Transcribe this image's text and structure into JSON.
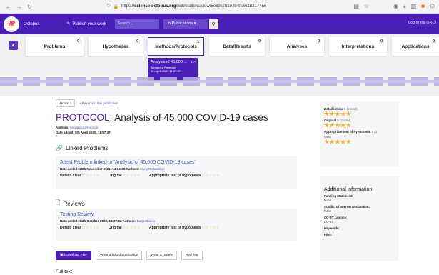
{
  "browser": {
    "url_prefix": "https://",
    "url_host": "science-octopus.org",
    "url_path": "/publications/view/5e89c7b1e4b4fc6618217455"
  },
  "appbar": {
    "brand": "Octopus",
    "publish": "Publish your work",
    "search_placeholder": "Search...",
    "scope": "in Publications",
    "login": "Log in via ORCI"
  },
  "stages": [
    {
      "label": "Problems",
      "count": "0"
    },
    {
      "label": "Hypotheses",
      "count": "0"
    },
    {
      "label": "Methods/Protocols",
      "count": "1"
    },
    {
      "label": "Data/Results",
      "count": "0"
    },
    {
      "label": "Analyses",
      "count": "0"
    },
    {
      "label": "Interpretations",
      "count": "0"
    },
    {
      "label": "Applications",
      "count": "0"
    }
  ],
  "pubcard": {
    "title": "Analysis of 45,000 ...",
    "count": "1",
    "author": "Alexandra Freeman",
    "date": "5th April 2020, 11:57:37"
  },
  "version": {
    "label": "Version 1",
    "reversion": "Reversion this publication"
  },
  "publication": {
    "type": "PROTOCOL:",
    "title": "Analysis of 45,000 COVID-19 cases",
    "authors_label": "Authors:",
    "author": "Alexandra Freeman",
    "date_added": "Date added: 5th April 2020, 11:57:37"
  },
  "linked": {
    "heading": "Linked Problems",
    "title": "A test Problem linked to 'Analysis of 45,000 COVID-19 cases'",
    "meta": "Date added: 18th November 2021, 14:14:30 Authors:",
    "author": "Carly Richardson",
    "details_clear": "Details clear",
    "original": "Original",
    "appropriate": "Appropriate test of hypothesis"
  },
  "reviews": {
    "heading": "Reviews",
    "title": "Testing Review",
    "meta": "Date added: 14th October 2020, 19:37:52 Authors:",
    "author": "Borja Blanco",
    "details_clear": "Details clear",
    "original": "Original",
    "appropriate": "Appropriate test of hypothesis"
  },
  "actions": {
    "download": "Download PDF",
    "linked": "Write a linked publication",
    "review": "Write a review",
    "flag": "Red flag"
  },
  "fulltext": "Full text",
  "ratings": {
    "details_clear": "Details clear",
    "details_total": "5 (2 total)",
    "original": "Original",
    "original_total": "5 (2 total)",
    "appropriate": "Appropriate test of hypothesis",
    "appropriate_total": "5 (2",
    "appropriate_total2": "total)",
    "stars_filled": "★★★★★",
    "stars_empty": "☆☆☆☆☆"
  },
  "additional": {
    "heading": "Additional information",
    "funding_label": "Funding Statement:",
    "funding": "None",
    "conflict_label": "Conflict of Interest Declaration:",
    "conflict": "None",
    "licence_label": "CC-BY Licence:",
    "licence": "CC-BY",
    "keywords_label": "Keywords:",
    "files_label": "Files:"
  }
}
